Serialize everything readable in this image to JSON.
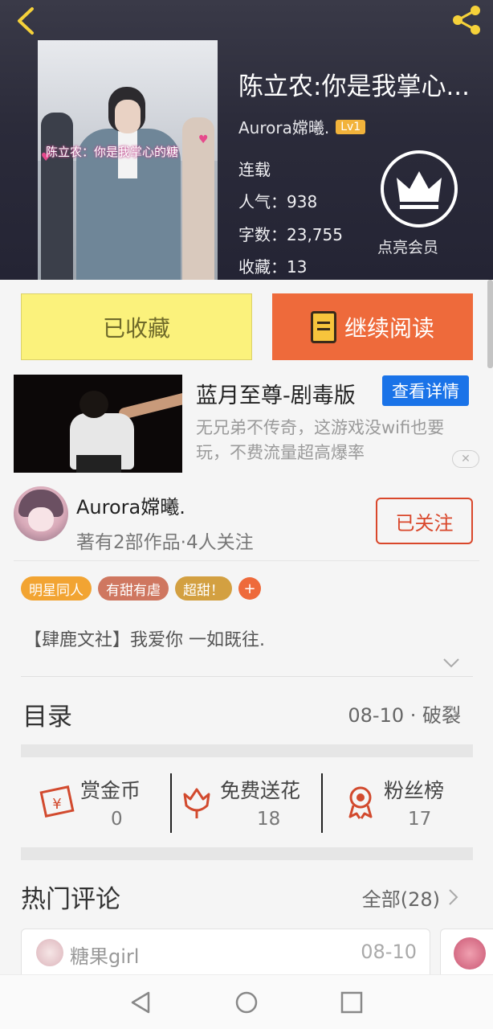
{
  "header": {
    "book_title": "陈立农:你是我掌心...",
    "cover_caption": "陈立农：你是我掌心的糖",
    "author": "Aurora嫦曦.",
    "level": "Lv1",
    "status": "连载",
    "popularity": "人气：938",
    "word_count": "字数：23,755",
    "favorites": "收藏：13",
    "vip_label": "点亮会员"
  },
  "actions": {
    "collected_label": "已收藏",
    "read_label": "继续阅读"
  },
  "ad": {
    "title": "蓝月至尊-剧毒版",
    "detail_label": "查看详情",
    "description": "无兄弟不传奇，这游戏没wifi也要玩，不费流量超高爆率",
    "close_label": "✕"
  },
  "author_card": {
    "name": "Aurora嫦曦.",
    "meta": "著有2部作品·4人关注",
    "follow_label": "已关注"
  },
  "tags": [
    "明星同人",
    "有甜有虐",
    "超甜！"
  ],
  "tag_add": "+",
  "intro": "【肆鹿文社】我爱你 一如既往.",
  "toc": {
    "title": "目录",
    "latest": "08-10 · 破裂"
  },
  "stats": [
    {
      "label": "赏金币",
      "value": "0",
      "icon": "red-envelope-icon"
    },
    {
      "label": "免费送花",
      "value": "18",
      "icon": "flower-icon"
    },
    {
      "label": "粉丝榜",
      "value": "17",
      "icon": "award-ribbon-icon"
    }
  ],
  "hot_comments": {
    "title": "热门评论",
    "all_label": "全部(28)",
    "first": {
      "user": "糖果girl",
      "date": "08-10"
    }
  },
  "colors": {
    "accent_orange": "#ee6a3b",
    "collected_yellow": "#fbf27c",
    "follow_red": "#d9472b",
    "ad_blue": "#1a73e8"
  }
}
